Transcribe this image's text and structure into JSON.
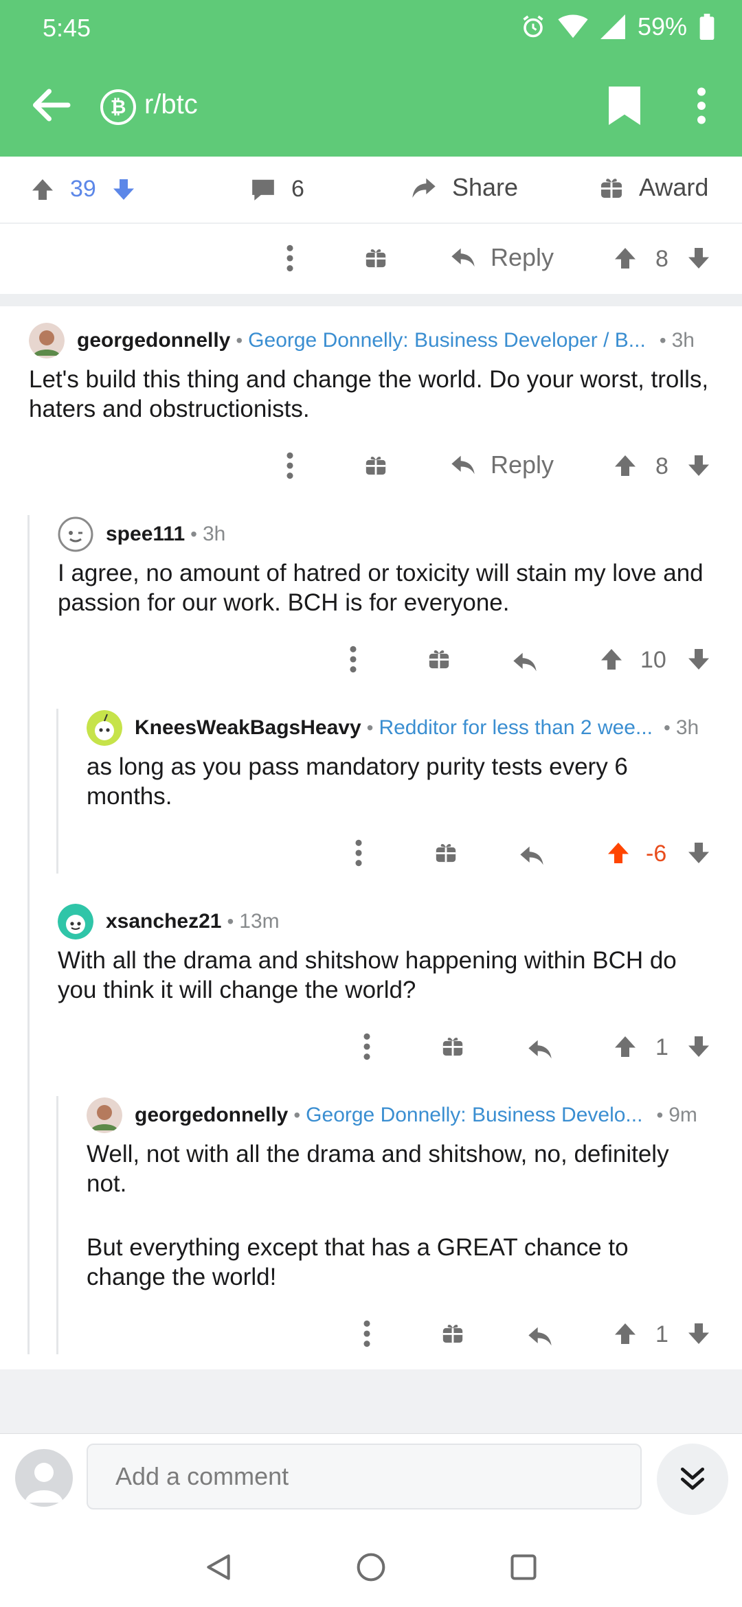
{
  "status_bar": {
    "time": "5:45",
    "battery": "59%"
  },
  "header": {
    "subreddit": "r/btc",
    "sub_icon": "bitcoin-logo"
  },
  "post_bar": {
    "score": "39",
    "comments": "6",
    "share_label": "Share",
    "award_label": "Award"
  },
  "top_comment_actions": {
    "reply_label": "Reply",
    "score": "8"
  },
  "comments": [
    {
      "user": "georgedonnelly",
      "flair": "George Donnelly: Business Developer / B...",
      "time": "3h",
      "body": "Let's build this thing and change the world. Do your worst, trolls, haters and obstructionists.",
      "reply_label": "Reply",
      "score": "8"
    },
    {
      "user": "spee111",
      "time": "3h",
      "body": "I agree, no amount of hatred or toxicity will stain my love and passion for our work. BCH is for everyone.",
      "score": "10"
    },
    {
      "user": "KneesWeakBagsHeavy",
      "flair": "Redditor for less than 2 wee...",
      "time": "3h",
      "body": "as long as you pass mandatory purity tests every 6 months.",
      "score": "-6"
    },
    {
      "user": "xsanchez21",
      "time": "13m",
      "body": "With all the drama and shitshow happening within BCH do you think it will change the world?",
      "score": "1"
    },
    {
      "user": "georgedonnelly",
      "flair": "George Donnelly: Business Develo...",
      "time": "9m",
      "body_p1": "Well, not with all the drama and shitshow, no, definitely not.",
      "body_p2": "But everything except that has a GREAT chance to change the world!",
      "score": "1"
    }
  ],
  "comment_input": {
    "placeholder": "Add a comment"
  },
  "colors": {
    "header": "#5fca78",
    "upvote_blue": "#5c87e8",
    "flair_blue": "#3a8ed1",
    "upvoted_orange": "#ff4500",
    "negative": "#e84c1c"
  }
}
